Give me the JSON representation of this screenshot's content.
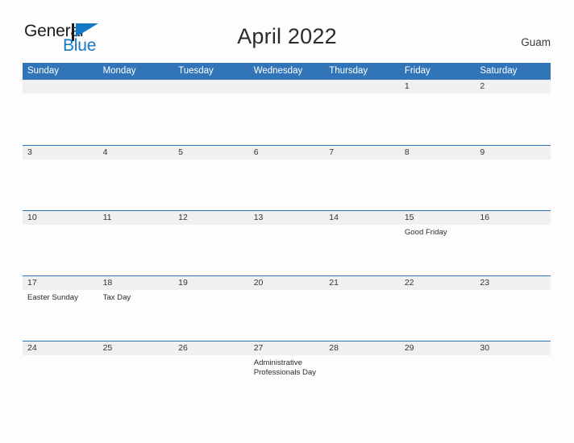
{
  "brand": {
    "name_part1": "General",
    "name_part2": "Blue",
    "flag_icon": "flag-triangle-icon",
    "color_dark": "#1c1c1c",
    "color_blue": "#1479c4"
  },
  "header": {
    "title": "April 2022",
    "location": "Guam"
  },
  "theme": {
    "header_blue": "#3175b8",
    "row_divider_blue": "#2e75b6",
    "day_band_gray": "#f0f0f0",
    "page_background": "#fdfdfd"
  },
  "calendar": {
    "weekday_headers": [
      "Sunday",
      "Monday",
      "Tuesday",
      "Wednesday",
      "Thursday",
      "Friday",
      "Saturday"
    ],
    "weeks": [
      [
        {
          "day": "",
          "events": []
        },
        {
          "day": "",
          "events": []
        },
        {
          "day": "",
          "events": []
        },
        {
          "day": "",
          "events": []
        },
        {
          "day": "",
          "events": []
        },
        {
          "day": "1",
          "events": []
        },
        {
          "day": "2",
          "events": []
        }
      ],
      [
        {
          "day": "3",
          "events": []
        },
        {
          "day": "4",
          "events": []
        },
        {
          "day": "5",
          "events": []
        },
        {
          "day": "6",
          "events": []
        },
        {
          "day": "7",
          "events": []
        },
        {
          "day": "8",
          "events": []
        },
        {
          "day": "9",
          "events": []
        }
      ],
      [
        {
          "day": "10",
          "events": []
        },
        {
          "day": "11",
          "events": []
        },
        {
          "day": "12",
          "events": []
        },
        {
          "day": "13",
          "events": []
        },
        {
          "day": "14",
          "events": []
        },
        {
          "day": "15",
          "events": [
            "Good Friday"
          ]
        },
        {
          "day": "16",
          "events": []
        }
      ],
      [
        {
          "day": "17",
          "events": [
            "Easter Sunday"
          ]
        },
        {
          "day": "18",
          "events": [
            "Tax Day"
          ]
        },
        {
          "day": "19",
          "events": []
        },
        {
          "day": "20",
          "events": []
        },
        {
          "day": "21",
          "events": []
        },
        {
          "day": "22",
          "events": []
        },
        {
          "day": "23",
          "events": []
        }
      ],
      [
        {
          "day": "24",
          "events": []
        },
        {
          "day": "25",
          "events": []
        },
        {
          "day": "26",
          "events": []
        },
        {
          "day": "27",
          "events": [
            "Administrative Professionals Day"
          ]
        },
        {
          "day": "28",
          "events": []
        },
        {
          "day": "29",
          "events": []
        },
        {
          "day": "30",
          "events": []
        }
      ]
    ]
  }
}
